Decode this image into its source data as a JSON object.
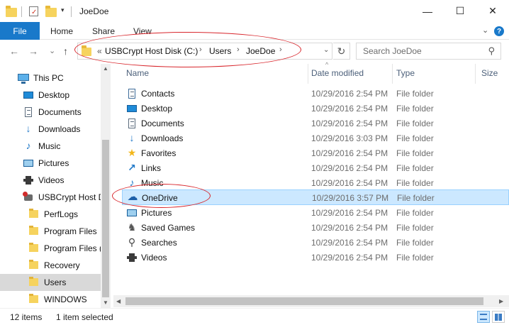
{
  "window": {
    "title": "JoeDoe",
    "minimize_glyph": "—",
    "maximize_glyph": "☐",
    "close_glyph": "✕"
  },
  "ribbon": {
    "tabs": [
      "File",
      "Home",
      "Share",
      "View"
    ],
    "expand_glyph": "⌄",
    "help_glyph": "?"
  },
  "nav": {
    "back_glyph": "←",
    "forward_glyph": "→",
    "recent_glyph": "⌄",
    "up_glyph": "↑"
  },
  "address": {
    "overflow": "«",
    "crumbs": [
      "USBCrypt Host Disk (C:)",
      "Users",
      "JoeDoe"
    ],
    "separator": "›",
    "dropdown_glyph": "⌄",
    "refresh_glyph": "↻"
  },
  "search": {
    "placeholder": "Search JoeDoe",
    "icon_glyph": "⚲"
  },
  "sidebar": {
    "items": [
      {
        "label": "This PC",
        "icon": "pc-icon"
      },
      {
        "label": "Desktop",
        "icon": "desktop-icon"
      },
      {
        "label": "Documents",
        "icon": "documents-icon"
      },
      {
        "label": "Downloads",
        "icon": "downloads-icon"
      },
      {
        "label": "Music",
        "icon": "music-icon"
      },
      {
        "label": "Pictures",
        "icon": "pictures-icon"
      },
      {
        "label": "Videos",
        "icon": "videos-icon"
      },
      {
        "label": "USBCrypt Host D",
        "icon": "drive-icon"
      },
      {
        "label": "PerfLogs",
        "icon": "folder-icon"
      },
      {
        "label": "Program Files",
        "icon": "folder-icon"
      },
      {
        "label": "Program Files (",
        "icon": "folder-icon"
      },
      {
        "label": "Recovery",
        "icon": "folder-icon"
      },
      {
        "label": "Users",
        "icon": "folder-icon",
        "selected": true
      },
      {
        "label": "WINDOWS",
        "icon": "folder-icon"
      }
    ]
  },
  "columns": {
    "name": "Name",
    "date": "Date modified",
    "type": "Type",
    "size": "Size",
    "sort_glyph": "^"
  },
  "files": [
    {
      "name": "Contacts",
      "date": "10/29/2016 2:54 PM",
      "type": "File folder",
      "icon": "contacts-icon"
    },
    {
      "name": "Desktop",
      "date": "10/29/2016 2:54 PM",
      "type": "File folder",
      "icon": "desktop-icon"
    },
    {
      "name": "Documents",
      "date": "10/29/2016 2:54 PM",
      "type": "File folder",
      "icon": "documents-icon"
    },
    {
      "name": "Downloads",
      "date": "10/29/2016 3:03 PM",
      "type": "File folder",
      "icon": "downloads-icon"
    },
    {
      "name": "Favorites",
      "date": "10/29/2016 2:54 PM",
      "type": "File folder",
      "icon": "favorites-icon"
    },
    {
      "name": "Links",
      "date": "10/29/2016 2:54 PM",
      "type": "File folder",
      "icon": "links-icon"
    },
    {
      "name": "Music",
      "date": "10/29/2016 2:54 PM",
      "type": "File folder",
      "icon": "music-icon"
    },
    {
      "name": "OneDrive",
      "date": "10/29/2016 3:57 PM",
      "type": "File folder",
      "icon": "onedrive-icon",
      "selected": true
    },
    {
      "name": "Pictures",
      "date": "10/29/2016 2:54 PM",
      "type": "File folder",
      "icon": "pictures-icon"
    },
    {
      "name": "Saved Games",
      "date": "10/29/2016 2:54 PM",
      "type": "File folder",
      "icon": "saved-games-icon"
    },
    {
      "name": "Searches",
      "date": "10/29/2016 2:54 PM",
      "type": "File folder",
      "icon": "searches-icon"
    },
    {
      "name": "Videos",
      "date": "10/29/2016 2:54 PM",
      "type": "File folder",
      "icon": "videos-icon"
    }
  ],
  "status": {
    "item_count": "12 items",
    "selection": "1 item selected"
  },
  "colors": {
    "accent": "#1979ca",
    "selection": "#cce8ff",
    "annotation": "#d8262c"
  }
}
